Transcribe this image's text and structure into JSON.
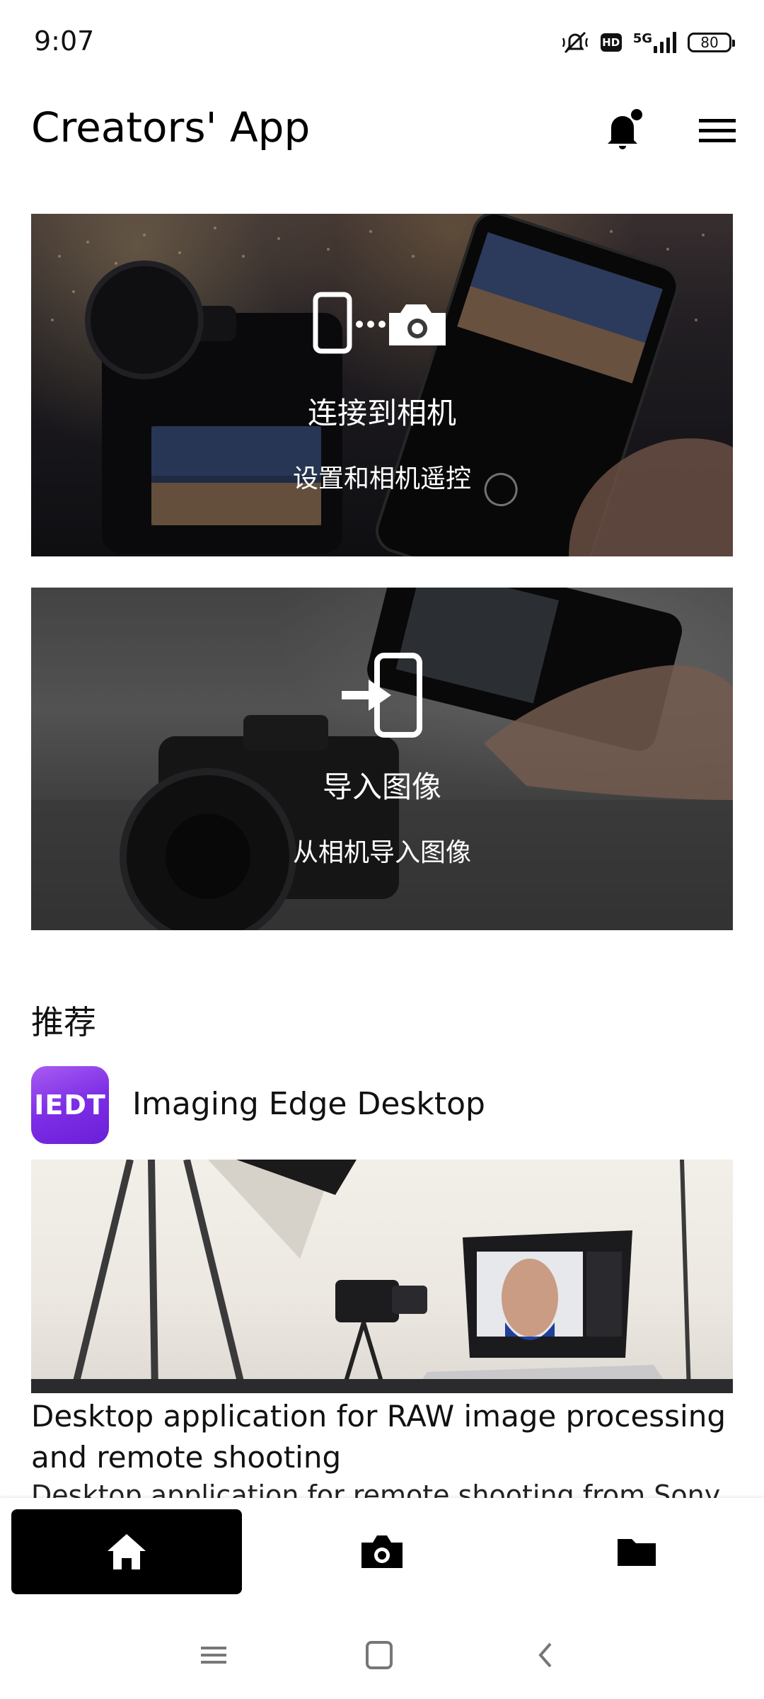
{
  "status_bar": {
    "time": "9:07",
    "network": "5G",
    "hd": "HD",
    "battery": "80"
  },
  "header": {
    "title": "Creators' App",
    "icons": [
      "bell-icon",
      "menu-icon"
    ]
  },
  "cards": {
    "connect": {
      "title": "连接到相机",
      "subtitle": "设置和相机遥控",
      "icon": "phone-camera-connect-icon"
    },
    "import": {
      "title": "导入图像",
      "subtitle": "从相机导入图像",
      "icon": "import-to-phone-icon"
    }
  },
  "recommended": {
    "section_title": "推荐",
    "app": {
      "logo_text": "IEDT",
      "name": "Imaging Edge Desktop",
      "headline": "Desktop application for RAW image processing and remote shooting",
      "description": "Desktop application for remote shooting from Sony"
    }
  },
  "bottom_nav": {
    "items": [
      {
        "icon": "home-icon",
        "active": true
      },
      {
        "icon": "camera-icon",
        "active": false
      },
      {
        "icon": "folder-icon",
        "active": false
      }
    ]
  },
  "system_nav": {
    "icons": [
      "recents-icon",
      "home-square-icon",
      "back-icon"
    ]
  },
  "colors": {
    "accent": "#000000",
    "logo_gradient_start": "#a85cf2",
    "logo_gradient_end": "#6a1fd6"
  }
}
